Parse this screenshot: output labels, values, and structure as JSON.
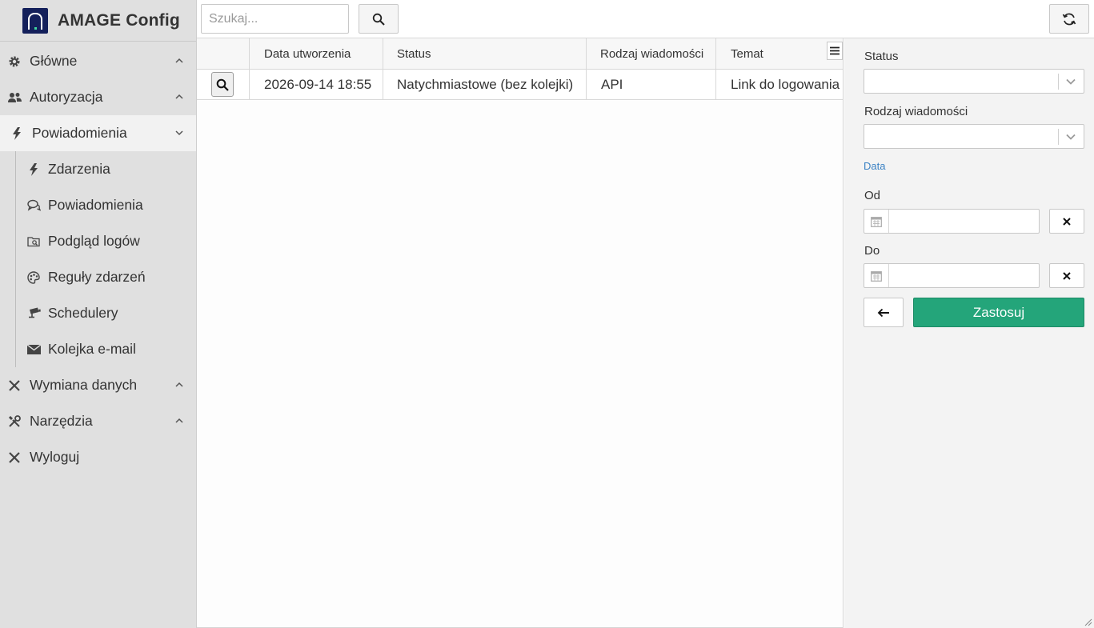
{
  "app": {
    "title": "AMAGE Config"
  },
  "sidebar": {
    "items": [
      {
        "label": "Główne",
        "icon": "gear-icon"
      },
      {
        "label": "Autoryzacja",
        "icon": "users-icon"
      },
      {
        "label": "Powiadomienia",
        "icon": "bolt-icon"
      },
      {
        "label": "Wymiana danych",
        "icon": "close-x-icon"
      },
      {
        "label": "Narzędzia",
        "icon": "tools-icon"
      },
      {
        "label": "Wyloguj",
        "icon": "close-x-icon"
      }
    ],
    "subitems": [
      {
        "label": "Zdarzenia",
        "icon": "bolt-icon"
      },
      {
        "label": "Powiadomienia",
        "icon": "chat-bubbles-icon"
      },
      {
        "label": "Podgląd logów",
        "icon": "folder-search-icon"
      },
      {
        "label": "Reguły zdarzeń",
        "icon": "palette-icon"
      },
      {
        "label": "Schedulery",
        "icon": "camera-icon"
      },
      {
        "label": "Kolejka e-mail",
        "icon": "envelope-icon"
      }
    ]
  },
  "toolbar": {
    "search_placeholder": "Szukaj..."
  },
  "grid": {
    "columns": [
      "Data utworzenia",
      "Status",
      "Rodzaj wiadomości",
      "Temat"
    ],
    "rows": [
      {
        "date": "2026-09-14 18:55",
        "status": "Natychmiastowe (bez kolejki)",
        "type": "API",
        "subject": "Link do logowania do systemu"
      }
    ]
  },
  "filters": {
    "status_label": "Status",
    "type_label": "Rodzaj wiadomości",
    "date_section": "Data",
    "from_label": "Od",
    "to_label": "Do",
    "apply_label": "Zastosuj"
  },
  "colors": {
    "accent": "#24a57a",
    "brand": "#14205b",
    "link": "#3b82c4"
  }
}
